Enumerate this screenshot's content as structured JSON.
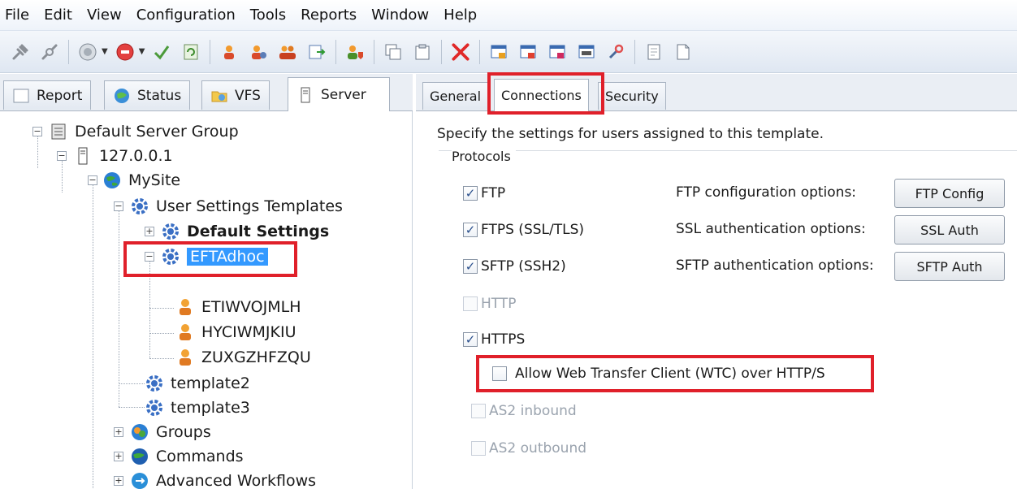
{
  "menu": [
    "File",
    "Edit",
    "View",
    "Configuration",
    "Tools",
    "Reports",
    "Window",
    "Help"
  ],
  "left_tabs": [
    {
      "label": "Report",
      "icon": "report-icon"
    },
    {
      "label": "Status",
      "icon": "status-icon"
    },
    {
      "label": "VFS",
      "icon": "vfs-folder-icon"
    },
    {
      "label": "Server",
      "icon": "server-icon"
    }
  ],
  "tree": {
    "server_group": "Default Server Group",
    "server": "127.0.0.1",
    "site": "MySite",
    "user_settings_templates": "User Settings Templates",
    "default_settings": "Default Settings",
    "eftadhoc": "EFTAdhoc",
    "users": [
      "ETIWVOJMLH",
      "HYCIWMJKIU",
      "ZUXGZHFZQU"
    ],
    "template2": "template2",
    "template3": "template3",
    "groups": "Groups",
    "commands": "Commands",
    "advanced_workflows": "Advanced Workflows"
  },
  "right_tabs": [
    "General",
    "Connections",
    "Security"
  ],
  "content": {
    "intro": "Specify the settings for users assigned to this template.",
    "protocols_label": "Protocols",
    "protocols": [
      {
        "label": "FTP",
        "checked": true,
        "enabled": true,
        "option_label": "FTP configuration options:",
        "button": "FTP Config"
      },
      {
        "label": "FTPS (SSL/TLS)",
        "checked": true,
        "enabled": true,
        "option_label": "SSL authentication options:",
        "button": "SSL Auth"
      },
      {
        "label": "SFTP (SSH2)",
        "checked": true,
        "enabled": true,
        "option_label": "SFTP authentication options:",
        "button": "SFTP Auth"
      },
      {
        "label": "HTTP",
        "checked": false,
        "enabled": false
      },
      {
        "label": "HTTPS",
        "checked": true,
        "enabled": true
      },
      {
        "label": "Allow Web Transfer Client (WTC) over HTTP/S",
        "checked": false,
        "enabled": true
      },
      {
        "label": "AS2 inbound",
        "checked": false,
        "enabled": false
      },
      {
        "label": "AS2 outbound",
        "checked": false,
        "enabled": false
      }
    ]
  },
  "colors": {
    "highlight": "#e0202a",
    "selection": "#3399ff"
  }
}
